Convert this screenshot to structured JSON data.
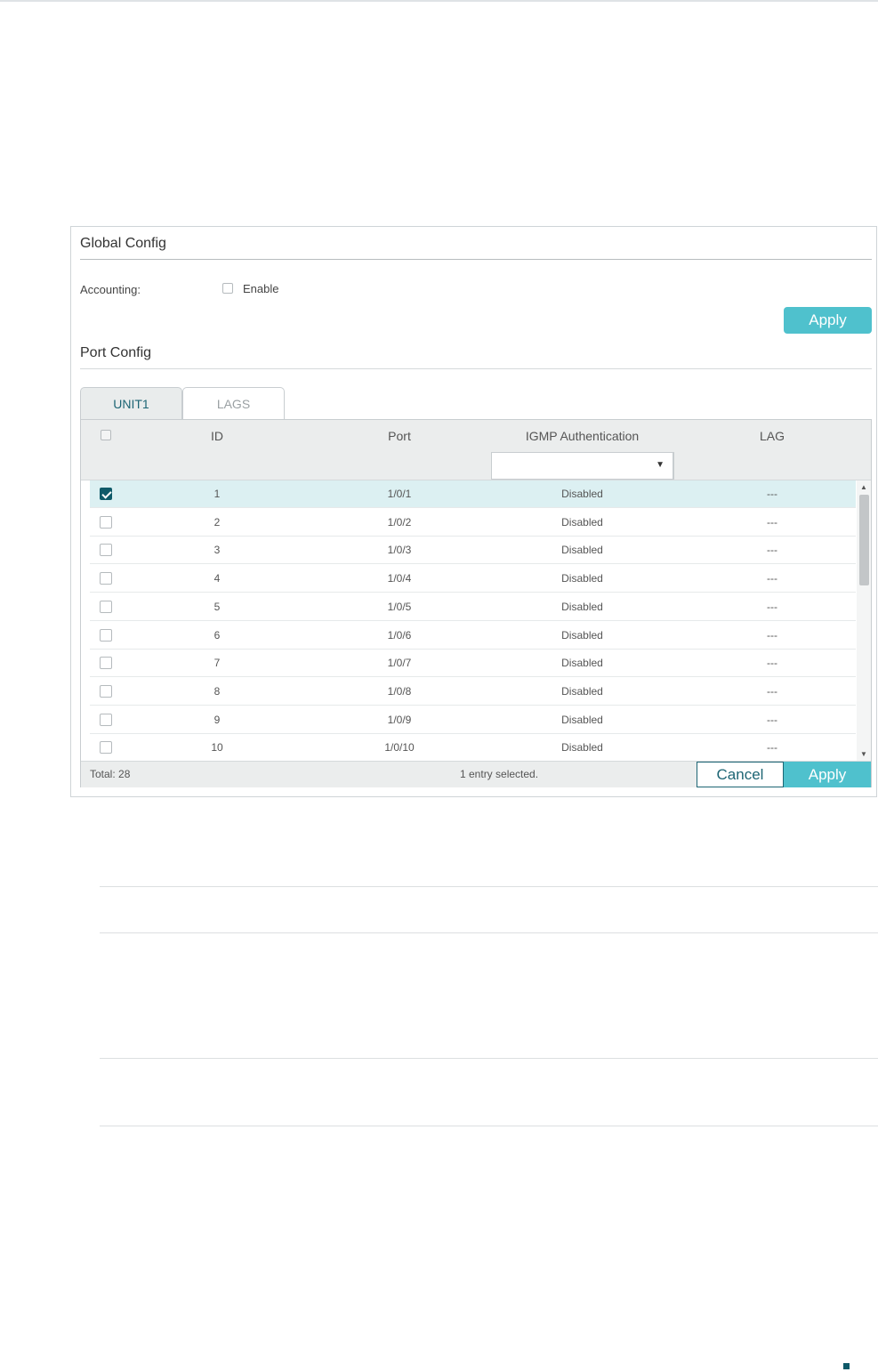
{
  "global_config": {
    "title": "Global Config",
    "accounting_label": "Accounting:",
    "enable_label": "Enable",
    "apply_label": "Apply"
  },
  "port_config": {
    "title": "Port Config",
    "tabs": [
      {
        "label": "UNIT1",
        "active": true
      },
      {
        "label": "LAGS",
        "active": false
      }
    ],
    "columns": {
      "id": "ID",
      "port": "Port",
      "igmp": "IGMP Authentication",
      "lag": "LAG"
    },
    "rows": [
      {
        "id": "1",
        "port": "1/0/1",
        "igmp": "Disabled",
        "lag": "---",
        "checked": true
      },
      {
        "id": "2",
        "port": "1/0/2",
        "igmp": "Disabled",
        "lag": "---",
        "checked": false
      },
      {
        "id": "3",
        "port": "1/0/3",
        "igmp": "Disabled",
        "lag": "---",
        "checked": false
      },
      {
        "id": "4",
        "port": "1/0/4",
        "igmp": "Disabled",
        "lag": "---",
        "checked": false
      },
      {
        "id": "5",
        "port": "1/0/5",
        "igmp": "Disabled",
        "lag": "---",
        "checked": false
      },
      {
        "id": "6",
        "port": "1/0/6",
        "igmp": "Disabled",
        "lag": "---",
        "checked": false
      },
      {
        "id": "7",
        "port": "1/0/7",
        "igmp": "Disabled",
        "lag": "---",
        "checked": false
      },
      {
        "id": "8",
        "port": "1/0/8",
        "igmp": "Disabled",
        "lag": "---",
        "checked": false
      },
      {
        "id": "9",
        "port": "1/0/9",
        "igmp": "Disabled",
        "lag": "---",
        "checked": false
      },
      {
        "id": "10",
        "port": "1/0/10",
        "igmp": "Disabled",
        "lag": "---",
        "checked": false
      }
    ],
    "footer": {
      "total": "Total: 28",
      "selected": "1 entry selected.",
      "cancel_label": "Cancel",
      "apply_label": "Apply"
    }
  },
  "colors": {
    "accent": "#4fc1cd",
    "dark_teal": "#0f5a69",
    "selected_row": "#dcf0f2"
  }
}
